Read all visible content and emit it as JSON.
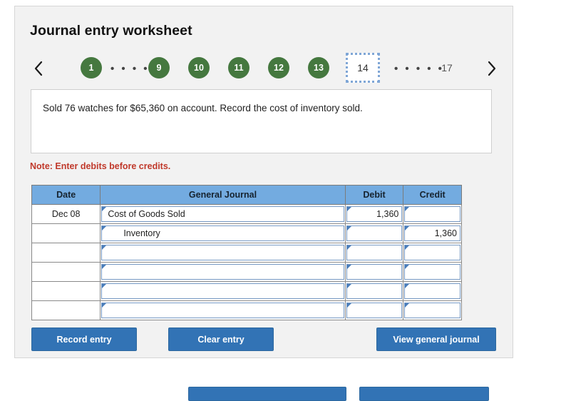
{
  "panel": {
    "title": "Journal entry worksheet"
  },
  "pager": {
    "prev_icon": "chevron-left-icon",
    "next_icon": "chevron-right-icon",
    "dots": "• • • • •",
    "steps": [
      {
        "label": "1",
        "state": "done"
      },
      {
        "label": "• • • • •",
        "state": "dots"
      },
      {
        "label": "9",
        "state": "done"
      },
      {
        "label": "10",
        "state": "done"
      },
      {
        "label": "11",
        "state": "done"
      },
      {
        "label": "12",
        "state": "done"
      },
      {
        "label": "13",
        "state": "done"
      },
      {
        "label": "14",
        "state": "current"
      },
      {
        "label": "• • • • •",
        "state": "dots"
      },
      {
        "label": "17",
        "state": "plain"
      }
    ]
  },
  "question": {
    "text": "Sold 76 watches for $65,360 on account. Record the cost of inventory sold."
  },
  "note": {
    "text": "Note: Enter debits before credits."
  },
  "journal": {
    "headers": {
      "date": "Date",
      "account": "General Journal",
      "debit": "Debit",
      "credit": "Credit"
    },
    "rows": [
      {
        "date": "Dec 08",
        "account": "Cost of Goods Sold",
        "indent": false,
        "debit": "1,360",
        "credit": ""
      },
      {
        "date": "",
        "account": "Inventory",
        "indent": true,
        "debit": "",
        "credit": "1,360"
      },
      {
        "date": "",
        "account": "",
        "indent": false,
        "debit": "",
        "credit": ""
      },
      {
        "date": "",
        "account": "",
        "indent": false,
        "debit": "",
        "credit": ""
      },
      {
        "date": "",
        "account": "",
        "indent": false,
        "debit": "",
        "credit": ""
      },
      {
        "date": "",
        "account": "",
        "indent": false,
        "debit": "",
        "credit": ""
      }
    ]
  },
  "actions": {
    "record_entry": "Record entry",
    "clear_entry": "Clear entry",
    "view_general_journal": "View general journal"
  },
  "colors": {
    "step_done": "#45783f",
    "table_header": "#73abe0",
    "button": "#3273b5",
    "note": "#c0392b",
    "input_border": "#7699c4",
    "panel_bg": "#f2f2f2"
  }
}
